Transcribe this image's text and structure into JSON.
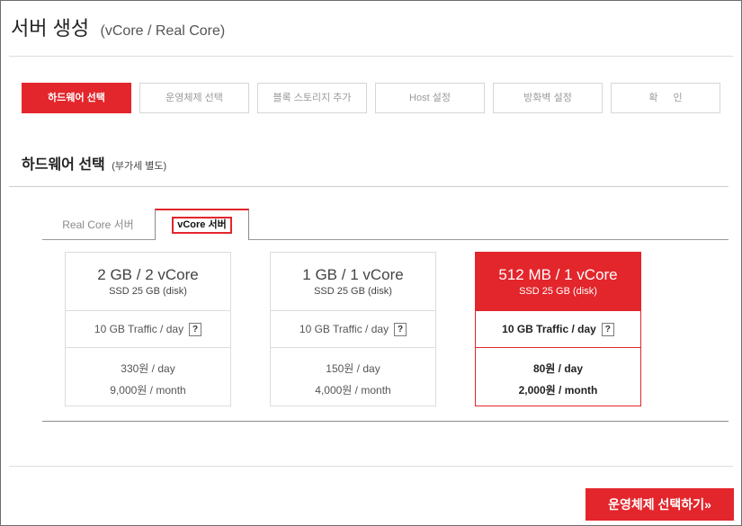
{
  "header": {
    "title": "서버 생성",
    "subtitle": "(vCore / Real Core)"
  },
  "steps": [
    {
      "label": "하드웨어 선택",
      "active": true
    },
    {
      "label": "운영체제 선택",
      "active": false
    },
    {
      "label": "블록 스토리지 추가",
      "active": false
    },
    {
      "label": "Host 설정",
      "active": false
    },
    {
      "label": "방화벽 설정",
      "active": false
    },
    {
      "label": "확 인",
      "active": false
    }
  ],
  "section": {
    "title": "하드웨어 선택",
    "note": "(부가세 별도)"
  },
  "server_tabs": [
    {
      "label": "Real Core 서버",
      "active": false
    },
    {
      "label": "vCore 서버",
      "active": true
    }
  ],
  "plans": [
    {
      "spec": "2 GB / 2 vCore",
      "disk": "SSD 25 GB (disk)",
      "traffic": "10 GB Traffic / day",
      "help_icon": "help-icon",
      "help_glyph": "?",
      "price_day": "330원 / day",
      "price_month": "9,000원 / month",
      "selected": false
    },
    {
      "spec": "1 GB / 1 vCore",
      "disk": "SSD 25 GB (disk)",
      "traffic": "10 GB Traffic / day",
      "help_icon": "help-icon",
      "help_glyph": "?",
      "price_day": "150원 / day",
      "price_month": "4,000원 / month",
      "selected": false
    },
    {
      "spec": "512 MB / 1 vCore",
      "disk": "SSD 25 GB (disk)",
      "traffic": "10 GB Traffic / day",
      "help_icon": "help-icon",
      "help_glyph": "?",
      "price_day": "80원 / day",
      "price_month": "2,000원 / month",
      "selected": true
    }
  ],
  "next_button": {
    "label": "운영체제 선택하기»"
  },
  "colors": {
    "accent": "#e3262c"
  }
}
